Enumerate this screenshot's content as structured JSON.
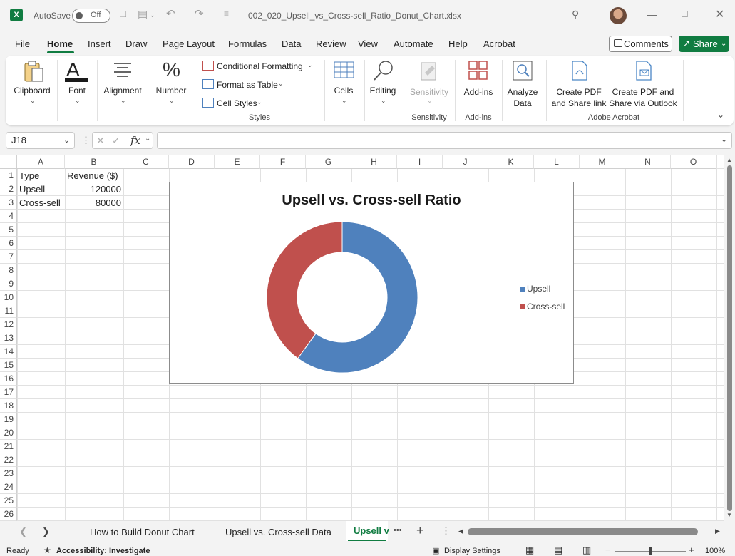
{
  "titlebar": {
    "autosave_label": "AutoSave",
    "autosave_state": "Off",
    "filename": "002_020_Upsell_vs_Cross-sell_Ratio_Donut_Chart.xlsx"
  },
  "menu": {
    "items": [
      "File",
      "Home",
      "Insert",
      "Draw",
      "Page Layout",
      "Formulas",
      "Data",
      "Review",
      "View",
      "Automate",
      "Help",
      "Acrobat"
    ],
    "active": "Home",
    "comments_label": "Comments",
    "share_label": "Share"
  },
  "ribbon": {
    "clipboard": "Clipboard",
    "font": "Font",
    "alignment": "Alignment",
    "number": "Number",
    "conditional_formatting": "Conditional Formatting",
    "format_as_table": "Format as Table",
    "cell_styles": "Cell Styles",
    "styles_group": "Styles",
    "cells": "Cells",
    "editing": "Editing",
    "sensitivity": "Sensitivity",
    "sensitivity_group": "Sensitivity",
    "addins": "Add-ins",
    "addins_group": "Add-ins",
    "analyze_line1": "Analyze",
    "analyze_line2": "Data",
    "create_pdf_line1": "Create PDF",
    "create_pdf_line2": "and Share link",
    "create_pdf_outlook_line1": "Create PDF and",
    "create_pdf_outlook_line2": "Share via Outlook",
    "acrobat_group": "Adobe Acrobat"
  },
  "formula_bar": {
    "name_box": "J18",
    "fx": "fx",
    "formula": ""
  },
  "sheet": {
    "columns": [
      "A",
      "B",
      "C",
      "D",
      "E",
      "F",
      "G",
      "H",
      "I",
      "J",
      "K",
      "L",
      "M",
      "N",
      "O"
    ],
    "rows": [
      "1",
      "2",
      "3",
      "4",
      "5",
      "6",
      "7",
      "8",
      "9",
      "10",
      "11",
      "12",
      "13",
      "14",
      "15",
      "16",
      "17",
      "18",
      "19",
      "20",
      "21",
      "22",
      "23",
      "24",
      "25",
      "26"
    ],
    "cells": {
      "A1": "Type",
      "B1": "Revenue ($)",
      "A2": "Upsell",
      "B2": "120000",
      "A3": "Cross-sell",
      "B3": "80000"
    }
  },
  "chart_data": {
    "type": "pie",
    "variant": "donut",
    "title": "Upsell vs. Cross-sell Ratio",
    "categories": [
      "Upsell",
      "Cross-sell"
    ],
    "values": [
      120000,
      80000
    ],
    "colors": [
      "#4f81bd",
      "#c0504d"
    ],
    "legend": "right"
  },
  "tabs": {
    "items": [
      "How to Build Donut Chart",
      "Upsell vs. Cross-sell Data",
      "Upsell v"
    ],
    "active_index": 2,
    "more": "•••",
    "add": "+"
  },
  "status": {
    "ready": "Ready",
    "accessibility": "Accessibility: Investigate",
    "display_settings": "Display Settings",
    "zoom": "100%"
  }
}
